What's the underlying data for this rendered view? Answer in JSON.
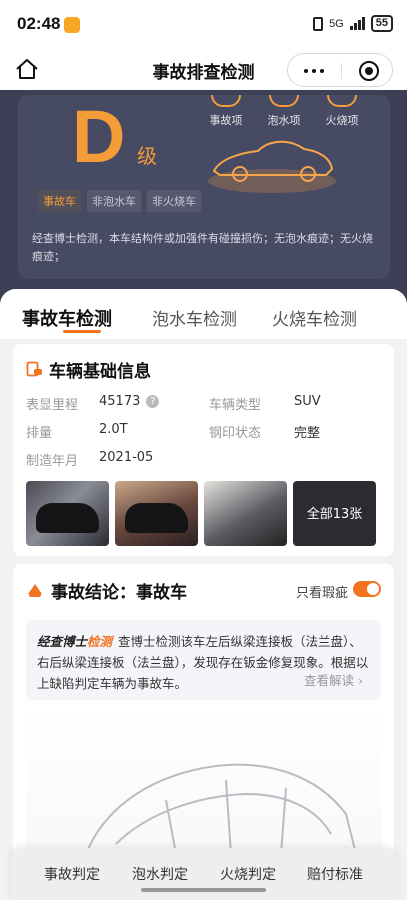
{
  "status_bar": {
    "time": "02:48",
    "network": "5G",
    "battery": "55"
  },
  "nav": {
    "title": "事故排查检测"
  },
  "hero": {
    "grade_letter": "D",
    "grade_suffix": "级",
    "icons": [
      {
        "label": "事故项",
        "icon": "accident-icon"
      },
      {
        "label": "泡水项",
        "icon": "water-icon"
      },
      {
        "label": "火烧项",
        "icon": "fire-icon"
      }
    ],
    "tags": [
      "事故车",
      "非泡水车",
      "非火烧车"
    ],
    "description": "经查博士检测，本车结构件或加强件有碰撞损伤；无泡水痕迹；无火烧痕迹；",
    "accent_color": "#f39c38"
  },
  "tabs": [
    "事故车检测",
    "泡水车检测",
    "火烧车检测"
  ],
  "basic_info": {
    "title": "车辆基础信息",
    "rows": [
      {
        "k1": "表显里程",
        "v1": "45173",
        "k2": "车辆类型",
        "v2": "SUV"
      },
      {
        "k1": "排量",
        "v1": "2.0T",
        "k2": "钢印状态",
        "v2": "完整"
      },
      {
        "k1": "制造年月",
        "v1": "2021-05",
        "k2": "",
        "v2": ""
      }
    ],
    "photos_all_label": "全部13张"
  },
  "conclusion": {
    "title": "事故结论：事故车",
    "toggle_label": "只看瑕疵",
    "toggle_on": true,
    "brand_prefix": "经查博士",
    "brand_suffix": "检测",
    "body": "查博士检测该车左后纵梁连接板（法兰盘）、右后纵梁连接板（法兰盘），发现存在钣金修复现象。根据以上缺陷判定车辆为事故车。",
    "read_more": "查看解读 ›"
  },
  "bottom_nav": [
    "事故判定",
    "泡水判定",
    "火烧判定",
    "赔付标准"
  ],
  "colors": {
    "brand_orange": "#f47321",
    "hero_bg": "#3c3f55"
  }
}
